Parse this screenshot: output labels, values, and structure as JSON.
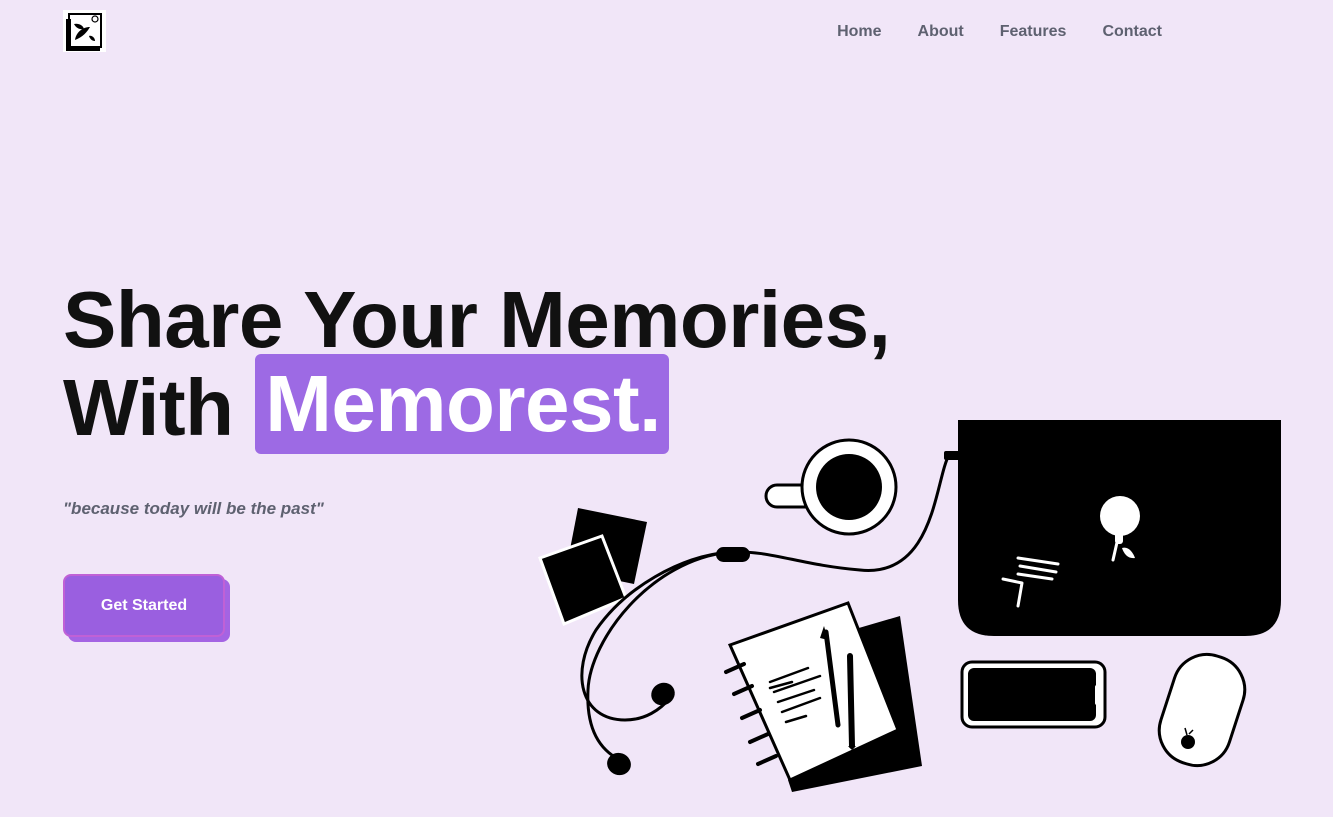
{
  "nav": {
    "items": [
      {
        "label": "Home"
      },
      {
        "label": "About"
      },
      {
        "label": "Features"
      },
      {
        "label": "Contact"
      }
    ]
  },
  "hero": {
    "title_line1": "Share Your Memories,",
    "title_line2_prefix": "With ",
    "title_highlight": "Memorest.",
    "tagline": "\"because today will be the past\"",
    "cta_label": "Get Started"
  },
  "colors": {
    "background": "#f1e6f8",
    "accent": "#9d6ae4",
    "button": "#9a5fe0",
    "button_border": "#c061d6",
    "text_dark": "#111111",
    "text_muted": "#5e6170"
  },
  "icons": {
    "logo": "memorest-logo-icon"
  }
}
